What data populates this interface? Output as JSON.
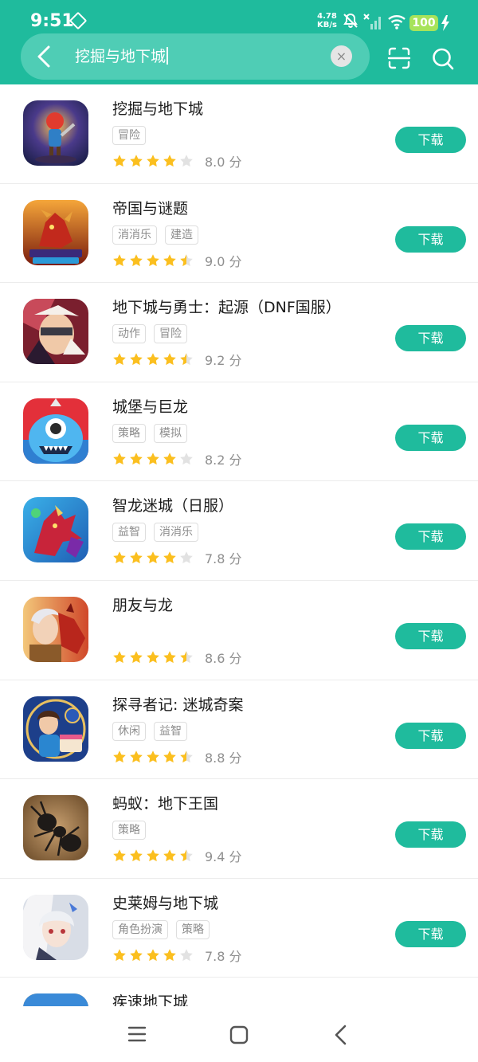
{
  "status_bar": {
    "time": "9:51",
    "net_speed_value": "4.78",
    "net_speed_unit": "KB/s",
    "battery": "100"
  },
  "search": {
    "query": "挖掘与地下城",
    "clear_symbol": "×"
  },
  "download_label": "下载",
  "score_unit": "分",
  "colors": {
    "accent": "#1fbb9d",
    "star_full": "#fbbf1f",
    "star_empty": "#e2e2e2"
  },
  "apps": [
    {
      "name": "挖掘与地下城",
      "tags": [
        "冒险"
      ],
      "rating": 4,
      "score": "8.0"
    },
    {
      "name": "帝国与谜题",
      "tags": [
        "消消乐",
        "建造"
      ],
      "rating": 4.5,
      "score": "9.0"
    },
    {
      "name": "地下城与勇士：起源（DNF国服）",
      "tags": [
        "动作",
        "冒险"
      ],
      "rating": 4.5,
      "score": "9.2"
    },
    {
      "name": "城堡与巨龙",
      "tags": [
        "策略",
        "模拟"
      ],
      "rating": 4,
      "score": "8.2"
    },
    {
      "name": "智龙迷城（日服）",
      "tags": [
        "益智",
        "消消乐"
      ],
      "rating": 4,
      "score": "7.8"
    },
    {
      "name": "朋友与龙",
      "tags": [],
      "rating": 4.5,
      "score": "8.6"
    },
    {
      "name": "探寻者记: 迷城奇案",
      "tags": [
        "休闲",
        "益智"
      ],
      "rating": 4.5,
      "score": "8.8"
    },
    {
      "name": "蚂蚁：地下王国",
      "tags": [
        "策略"
      ],
      "rating": 4.5,
      "score": "9.4"
    },
    {
      "name": "史莱姆与地下城",
      "tags": [
        "角色扮演",
        "策略"
      ],
      "rating": 4,
      "score": "7.8"
    },
    {
      "name": "疾速地下城",
      "tags": [],
      "rating": 0,
      "score": ""
    }
  ]
}
